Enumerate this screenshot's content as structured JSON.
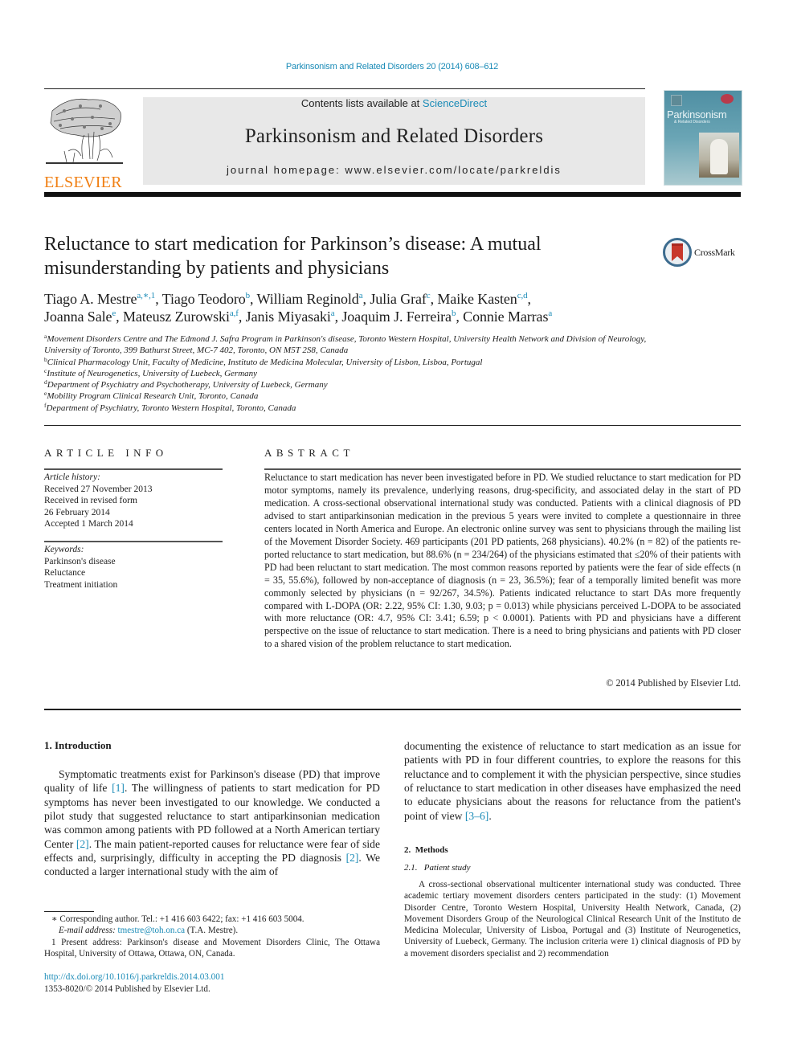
{
  "journal_citation": "Parkinsonism and Related Disorders 20 (2014) 608–612",
  "publisher": {
    "wordmark": "ELSEVIER",
    "logo_icon": "elsevier-tree-icon",
    "brand_color": "#f07f13"
  },
  "masthead": {
    "contents_prefix": "Contents lists available at ",
    "contents_link": "ScienceDirect",
    "journal_name": "Parkinsonism and Related Disorders",
    "homepage_label": "journal homepage: ",
    "homepage_url_text": "www.elsevier.com/locate/parkreldis",
    "background_color": "#e8e8e8",
    "link_color": "#1a8bb7"
  },
  "cover": {
    "title": "Parkinsonism",
    "subtitle": "& Related Disorders"
  },
  "crossmark": {
    "label": "CrossMark"
  },
  "article": {
    "title": "Reluctance to start medication for Parkinson’s disease: A mutual misunderstanding by patients and physicians",
    "authors": [
      {
        "name": "Tiago A. Mestre",
        "sup": "a,∗,1"
      },
      {
        "name": "Tiago Teodoro",
        "sup": "b"
      },
      {
        "name": "William Reginold",
        "sup": "a"
      },
      {
        "name": "Julia Graf",
        "sup": "c"
      },
      {
        "name": "Maike Kasten",
        "sup": "c,d"
      },
      {
        "name": "Joanna Sale",
        "sup": "e"
      },
      {
        "name": "Mateusz Zurowski",
        "sup": "a,f"
      },
      {
        "name": "Janis Miyasaki",
        "sup": "a"
      },
      {
        "name": "Joaquim J. Ferreira",
        "sup": "b"
      },
      {
        "name": "Connie Marras",
        "sup": "a"
      }
    ],
    "affiliations": [
      {
        "key": "a",
        "text": "Movement Disorders Centre and The Edmond J. Safra Program in Parkinson's disease, Toronto Western Hospital, University Health Network and Division of Neurology, University of Toronto, 399 Bathurst Street, MC-7 402, Toronto, ON M5T 2S8, Canada"
      },
      {
        "key": "b",
        "text": "Clinical Pharmacology Unit, Faculty of Medicine, Instituto de Medicina Molecular, University of Lisbon, Lisboa, Portugal"
      },
      {
        "key": "c",
        "text": "Institute of Neurogenetics, University of Luebeck, Germany"
      },
      {
        "key": "d",
        "text": "Department of Psychiatry and Psychotherapy, University of Luebeck, Germany"
      },
      {
        "key": "e",
        "text": "Mobility Program Clinical Research Unit, Toronto, Canada"
      },
      {
        "key": "f",
        "text": "Department of Psychiatry, Toronto Western Hospital, Toronto, Canada"
      }
    ]
  },
  "article_info": {
    "heading": "ARTICLE INFO",
    "history_label": "Article history:",
    "history": [
      "Received 27 November 2013",
      "Received in revised form",
      "26 February 2014",
      "Accepted 1 March 2014"
    ],
    "keywords_label": "Keywords:",
    "keywords": [
      "Parkinson's disease",
      "Reluctance",
      "Treatment initiation"
    ]
  },
  "abstract": {
    "heading": "ABSTRACT",
    "text": "Reluctance to start medication has never been investigated before in PD. We studied reluctance to start medication for PD motor symptoms, namely its prevalence, underlying reasons, drug-specificity, and associated delay in the start of PD medication. A cross-sectional observational international study was conducted. Patients with a clinical diagnosis of PD advised to start antiparkinsonian medication in the previous 5 years were invited to complete a questionnaire in three centers located in North America and Europe. An electronic online survey was sent to physicians through the mailing list of the Movement Disorder Society. 469 participants (201 PD patients, 268 physicians). 40.2% (n = 82) of the patients re­ported reluctance to start medication, but 88.6% (n = 234/264) of the physicians estimated that ≤20% of their patients with PD had been reluctant to start medication. The most common reasons reported by patients were the fear of side effects (n = 35, 55.6%), followed by non-acceptance of diagnosis (n = 23, 36.5%); fear of a temporally limited benefit was more commonly selected by physicians (n = 92/267, 34.5%). Patients indicated reluctance to start DAs more frequently compared with L-DOPA (OR: 2.22, 95% CI: 1.30, 9.03; p = 0.013) while physicians perceived L-DOPA to be associated with more reluctance (OR: 4.7, 95% CI: 3.41; 6.59; p < 0.0001). Patients with PD and physicians have a different perspective on the issue of reluctance to start medication. There is a need to bring physicians and patients with PD closer to a shared vision of the problem reluctance to start medication.",
    "copyright": "© 2014 Published by Elsevier Ltd."
  },
  "introduction": {
    "heading": "1.  Introduction",
    "p1_a": "Symptomatic treatments exist for Parkinson's disease (PD) that improve quality of life ",
    "ref1": "[1]",
    "p1_b": ". The willingness of patients to start medication for PD symptoms has never been investigated to our knowledge. We conducted a pilot study that suggested reluctance to start antiparkinsonian medication was common among patients with PD followed at a North American tertiary Center ",
    "ref2": "[2]",
    "p1_c": ". The main patient-reported causes for reluctance were fear of side effects and, surprisingly, difficulty in accepting the PD diagnosis ",
    "ref3": "[2]",
    "p1_d": ". We conducted a larger international study with the aim of",
    "p1_cont": "documenting the existence of reluctance to start medication as an issue for patients with PD in four different countries, to explore the reasons for this reluctance and to complement it with the physician perspective, since studies of reluctance to start medication in other diseases have emphasized the need to educate physicians about the reasons for reluctance from the patient's point of view ",
    "ref4": "[3–6]",
    "p1_end": "."
  },
  "methods": {
    "heading": "2.  Methods",
    "subheading": "2.1.   Patient study",
    "text": "A cross-sectional observational multicenter international study was conducted. Three academic tertiary movement disorders centers participated in the study: (1) Movement Disorder Centre, Toronto Western Hospital, University Health Network, Canada, (2) Movement Disorders Group of the Neurological Clinical Research Unit of the Instituto de Medicina Molecular, University of Lisboa, Portugal and (3) Institute of Neurogenetics, University of Luebeck, Germany. The inclusion criteria were 1) clinical diagnosis of PD by a movement disorders specialist and 2) recommendation"
  },
  "footnotes": {
    "corresponding": "∗  Corresponding author. Tel.: +1 416 603 6422; fax: +1 416 603 5004.",
    "email_label": "E-mail address: ",
    "email": "tmestre@toh.on.ca",
    "email_suffix": " (T.A. Mestre).",
    "present_address": "1  Present address: Parkinson's disease and Movement Disorders Clinic, The Ottawa Hospital, University of Ottawa, Ottawa, ON, Canada.",
    "doi": "http://dx.doi.org/10.1016/j.parkreldis.2014.03.001",
    "issn": "1353-8020/© 2014 Published by Elsevier Ltd."
  }
}
